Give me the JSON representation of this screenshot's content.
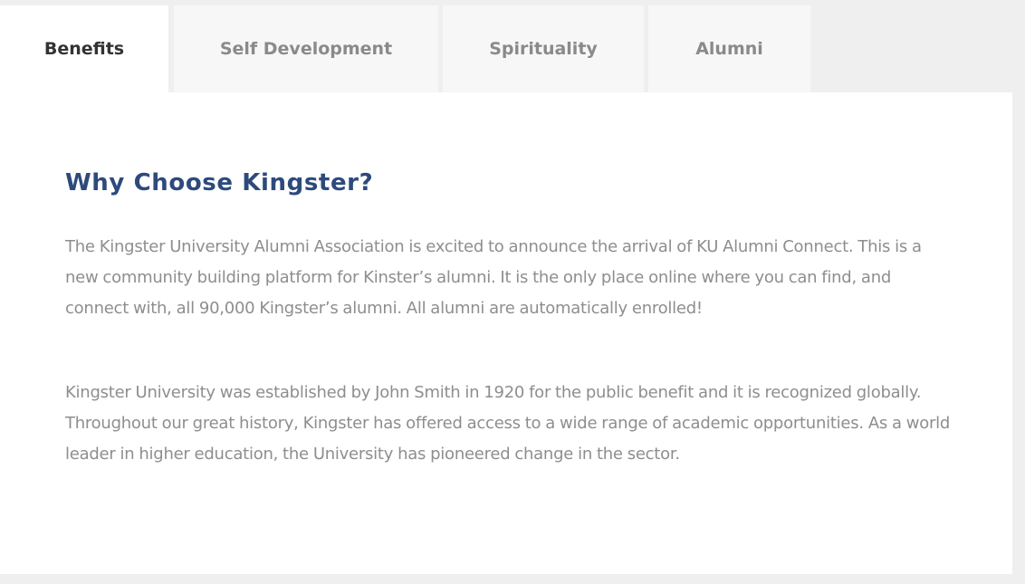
{
  "tabs": [
    {
      "label": "Benefits",
      "active": true
    },
    {
      "label": "Self Development",
      "active": false
    },
    {
      "label": "Spirituality",
      "active": false
    },
    {
      "label": "Alumni",
      "active": false
    }
  ],
  "panel": {
    "heading": "Why Choose Kingster?",
    "paragraphs": [
      "The Kingster University Alumni Association is excited to announce the arrival of KU Alumni Connect. This is a new community building platform for Kinster’s alumni. It is the only place online where you can find, and connect with, all 90,000 Kingster’s alumni. All alumni are automatically enrolled!",
      "Kingster University was established by John Smith in 1920 for the public benefit and it is recognized globally. Throughout our great history, Kingster has offered access to a wide range of academic opportunities. As a world leader in higher education, the University has pioneered change in the sector."
    ]
  },
  "colors": {
    "heading": "#2d4a7c",
    "body_text": "#8e8e8e",
    "active_tab_text": "#333333",
    "inactive_tab_text": "#8a8a8a",
    "page_background": "#efefef",
    "inactive_tab_background": "#f7f7f7",
    "panel_background": "#ffffff"
  }
}
